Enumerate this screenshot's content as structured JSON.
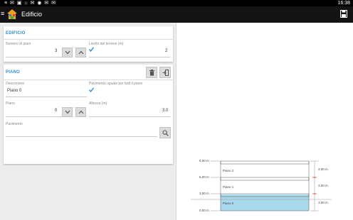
{
  "statusbar": {
    "left_icons": "≡ ✉ ▣ ⌂ ✉ ◉ ✉ ✉",
    "time": "16:38"
  },
  "appbar": {
    "title": "Edificio"
  },
  "edificio": {
    "title": "EDIFICIO",
    "numero_piani_label": "Numero di piani",
    "numero_piani_value": "3",
    "livello_terreno_label": "Livello del terreno (m)",
    "livello_terreno_value": "2"
  },
  "piano": {
    "title": "PIANO",
    "descrizione_label": "Descrizione",
    "descrizione_value": "Piano 0",
    "pavimento_uguale_label": "Pavimento uguale per tutti il piano",
    "piano_label": "Piano",
    "piano_value": "0",
    "altezza_label": "Altezza (m)",
    "altezza_value": "3.0",
    "pavimento_label": "Pavimento",
    "pavimento_value": ""
  },
  "drawing": {
    "elevations": [
      "9,00 m",
      "6,00 m",
      "3,00 m",
      "0,00 m"
    ],
    "floors": [
      "Piano 2",
      "Piano 1",
      "Piano 0"
    ],
    "heights": [
      "3,00 m",
      "3,00 m",
      "3,00 m"
    ],
    "selected_fill": "#a9d9ec"
  },
  "colors": {
    "accent": "#2b8fd1",
    "appbar": "#141414",
    "background": "#ececec"
  }
}
